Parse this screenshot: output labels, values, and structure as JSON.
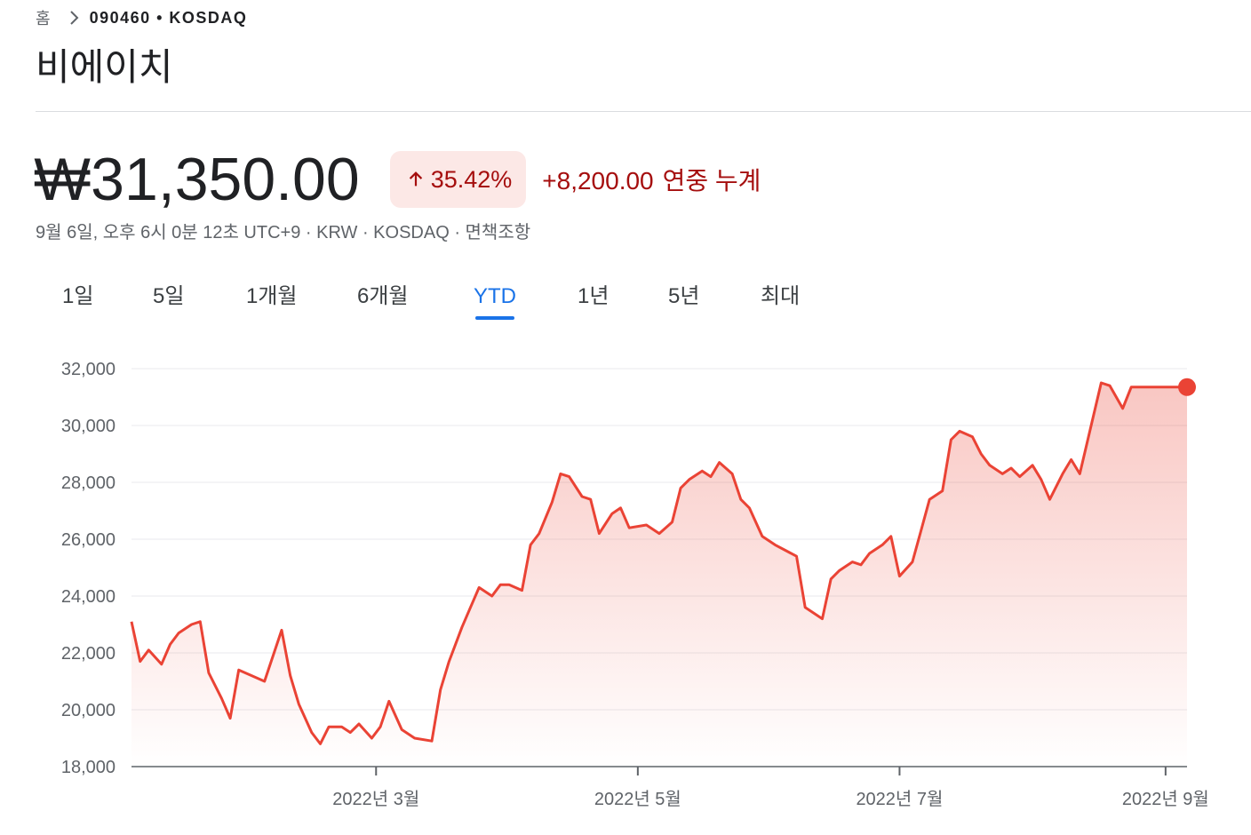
{
  "breadcrumb": {
    "home": "홈",
    "code": "090460 • KOSDAQ"
  },
  "title": "비에이치",
  "price": "₩31,350.00",
  "change": {
    "percent": "35.42%",
    "amount": "+8,200.00",
    "label": "연중 누계",
    "direction": "up"
  },
  "meta": "9월 6일, 오후 6시 0분 12초 UTC+9 · KRW · KOSDAQ · 면책조항",
  "tabs": [
    "1일",
    "5일",
    "1개월",
    "6개월",
    "YTD",
    "1년",
    "5년",
    "최대"
  ],
  "active_tab": "YTD",
  "colors": {
    "line": "#ea4335",
    "accent": "#1a73e8",
    "negative_text": "#a50e0e",
    "badge_bg": "#fce8e6"
  },
  "chart_data": {
    "type": "area",
    "ylim": [
      18000,
      32000
    ],
    "yticks": [
      "32,000",
      "30,000",
      "28,000",
      "26,000",
      "24,000",
      "22,000",
      "20,000",
      "18,000"
    ],
    "xticks": [
      "2022년 3월",
      "2022년 5월",
      "2022년 7월",
      "2022년 9월"
    ],
    "grid": true,
    "x": [
      "2022-01-03",
      "2022-01-05",
      "2022-01-07",
      "2022-01-10",
      "2022-01-12",
      "2022-01-14",
      "2022-01-17",
      "2022-01-19",
      "2022-01-21",
      "2022-01-24",
      "2022-01-26",
      "2022-01-28",
      "2022-02-03",
      "2022-02-07",
      "2022-02-09",
      "2022-02-11",
      "2022-02-14",
      "2022-02-16",
      "2022-02-18",
      "2022-02-21",
      "2022-02-23",
      "2022-02-25",
      "2022-02-28",
      "2022-03-02",
      "2022-03-04",
      "2022-03-07",
      "2022-03-10",
      "2022-03-14",
      "2022-03-16",
      "2022-03-18",
      "2022-03-21",
      "2022-03-23",
      "2022-03-25",
      "2022-03-28",
      "2022-03-30",
      "2022-04-01",
      "2022-04-04",
      "2022-04-06",
      "2022-04-08",
      "2022-04-11",
      "2022-04-13",
      "2022-04-15",
      "2022-04-18",
      "2022-04-20",
      "2022-04-22",
      "2022-04-25",
      "2022-04-27",
      "2022-04-29",
      "2022-05-03",
      "2022-05-06",
      "2022-05-09",
      "2022-05-11",
      "2022-05-13",
      "2022-05-16",
      "2022-05-18",
      "2022-05-20",
      "2022-05-23",
      "2022-05-25",
      "2022-05-27",
      "2022-05-30",
      "2022-06-02",
      "2022-06-07",
      "2022-06-09",
      "2022-06-13",
      "2022-06-15",
      "2022-06-17",
      "2022-06-20",
      "2022-06-22",
      "2022-06-24",
      "2022-06-27",
      "2022-06-29",
      "2022-07-01",
      "2022-07-04",
      "2022-07-06",
      "2022-07-08",
      "2022-07-11",
      "2022-07-13",
      "2022-07-15",
      "2022-07-18",
      "2022-07-20",
      "2022-07-22",
      "2022-07-25",
      "2022-07-27",
      "2022-07-29",
      "2022-08-01",
      "2022-08-03",
      "2022-08-05",
      "2022-08-08",
      "2022-08-10",
      "2022-08-12",
      "2022-08-17",
      "2022-08-19",
      "2022-08-22",
      "2022-08-24",
      "2022-08-26",
      "2022-08-29",
      "2022-08-31",
      "2022-09-02",
      "2022-09-05",
      "2022-09-06"
    ],
    "values": [
      23100,
      21700,
      22100,
      21600,
      22300,
      22700,
      23000,
      23100,
      21300,
      20400,
      19700,
      21400,
      21000,
      22800,
      21200,
      20200,
      19200,
      18800,
      19400,
      19400,
      19200,
      19500,
      19000,
      19400,
      20300,
      19300,
      19000,
      18900,
      20700,
      21700,
      22900,
      23600,
      24300,
      24000,
      24400,
      24400,
      24200,
      25800,
      26200,
      27300,
      28300,
      28200,
      27500,
      27400,
      26200,
      26900,
      27100,
      26400,
      26500,
      26200,
      26600,
      27800,
      28100,
      28400,
      28200,
      28700,
      28300,
      27400,
      27100,
      26100,
      25800,
      25400,
      23600,
      23200,
      24600,
      24900,
      25200,
      25100,
      25500,
      25800,
      26100,
      24700,
      25200,
      26300,
      27400,
      27700,
      29500,
      29800,
      29600,
      29000,
      28600,
      28300,
      28500,
      28200,
      28600,
      28100,
      27400,
      28300,
      28800,
      28300,
      31500,
      31400,
      30600,
      31350,
      31350,
      31350,
      31350,
      31350,
      31350,
      31350
    ],
    "last_value": 31350
  }
}
